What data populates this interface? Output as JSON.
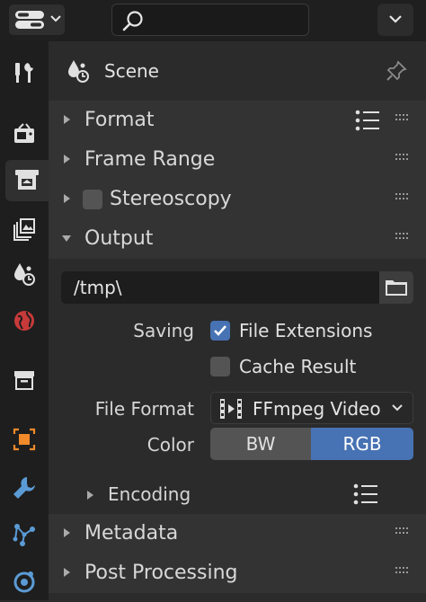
{
  "header": {
    "editor_type_icon": "properties-editor-icon",
    "search_icon": "search-icon",
    "search_placeholder": "",
    "dropdown_icon": "chevron-down-icon"
  },
  "tabs": [
    {
      "name": "tool",
      "icon": "tool-icon"
    },
    {
      "name": "render",
      "icon": "render-icon"
    },
    {
      "name": "output",
      "icon": "output-icon",
      "active": true
    },
    {
      "name": "view-layer",
      "icon": "view-layer-icon"
    },
    {
      "name": "scene",
      "icon": "scene-icon"
    },
    {
      "name": "world",
      "icon": "world-icon"
    },
    {
      "name": "collection",
      "icon": "collection-icon"
    },
    {
      "name": "object",
      "icon": "object-icon"
    },
    {
      "name": "modifiers",
      "icon": "wrench-icon"
    },
    {
      "name": "particles",
      "icon": "particles-icon"
    },
    {
      "name": "physics",
      "icon": "physics-icon"
    }
  ],
  "context": {
    "label": "Scene",
    "pin_icon": "pin-icon"
  },
  "panels": {
    "format": "Format",
    "frame_range": "Frame Range",
    "stereoscopy": "Stereoscopy",
    "output": "Output",
    "metadata": "Metadata",
    "post_processing": "Post Processing"
  },
  "output": {
    "path": "/tmp\\",
    "saving_label": "Saving",
    "file_extensions_label": "File Extensions",
    "file_extensions_checked": true,
    "cache_result_label": "Cache Result",
    "cache_result_checked": false,
    "file_format_label": "File Format",
    "file_format_value": "FFmpeg Video",
    "color_label": "Color",
    "color_options": [
      "BW",
      "RGB"
    ],
    "color_selected": "RGB",
    "encoding_label": "Encoding"
  },
  "colors": {
    "accent": "#4772b3",
    "background": "#2b2b2b",
    "panel_header": "#333333"
  }
}
